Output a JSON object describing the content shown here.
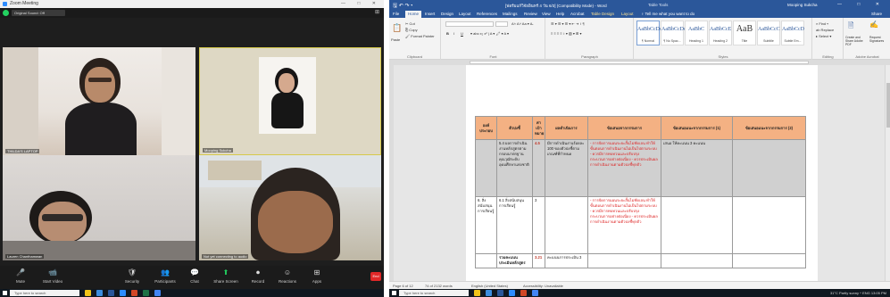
{
  "zoom": {
    "title": "Zoom Meeting",
    "window_controls": "— □ ✕",
    "original_sound": "Original Sound: Off",
    "gallery_icon": "gallery-view-icon",
    "participants": [
      {
        "name": "THILDA'S LAPTOP"
      },
      {
        "name": "Mooping Sukcha"
      },
      {
        "name": "Lauren Chanthamwan"
      },
      {
        "name": "Not yet connecting to audio"
      }
    ],
    "controls": [
      {
        "label": "Mute",
        "icon": "🎤",
        "name": "mute"
      },
      {
        "label": "Start Video",
        "icon": "📹",
        "name": "start-video"
      },
      {
        "label": "Security",
        "icon": "🛡",
        "name": "security"
      },
      {
        "label": "Participants",
        "icon": "👥",
        "name": "participants"
      },
      {
        "label": "Chat",
        "icon": "💬",
        "name": "chat"
      },
      {
        "label": "Share Screen",
        "icon": "⬆",
        "name": "share-screen",
        "accent": true
      },
      {
        "label": "Record",
        "icon": "⏺",
        "name": "record"
      },
      {
        "label": "Reactions",
        "icon": "☺",
        "name": "reactions"
      },
      {
        "label": "Apps",
        "icon": "⊞",
        "name": "apps"
      }
    ],
    "end_label": "End"
  },
  "word": {
    "quick_access": "🖫 ↶ ↷ ▾",
    "doc_title": "[ฟอร์มแก้วิจัยอินทร์ 4 วัน 6/3] (Compatibility Mode) - Word",
    "context_tab": "Table Tools",
    "user": "Mooping Sukcha",
    "window_controls": "— □ ✕",
    "tabs": [
      {
        "label": "File",
        "active": false
      },
      {
        "label": "Home",
        "active": true
      },
      {
        "label": "Insert",
        "active": false
      },
      {
        "label": "Design",
        "active": false
      },
      {
        "label": "Layout",
        "active": false
      },
      {
        "label": "References",
        "active": false
      },
      {
        "label": "Mailings",
        "active": false
      },
      {
        "label": "Review",
        "active": false
      },
      {
        "label": "View",
        "active": false
      },
      {
        "label": "Help",
        "active": false
      },
      {
        "label": "Acrobat",
        "active": false
      },
      {
        "label": "Table Design",
        "active": false,
        "tool": true
      },
      {
        "label": "Layout",
        "active": false,
        "tool": true
      },
      {
        "label": "♀ Tell me what you want to do",
        "active": false
      }
    ],
    "share_label": "Share",
    "ribbon": {
      "clipboard": {
        "paste": "Paste",
        "cut": "✂ Cut",
        "copy": "⎘ Copy",
        "format_painter": "🖌 Format Painter",
        "label": "Clipboard"
      },
      "font": {
        "bold": "B",
        "italic": "I",
        "underline": "U",
        "label": "Font"
      },
      "paragraph": {
        "label": "Paragraph"
      },
      "styles": {
        "label": "Styles",
        "items": [
          {
            "sample": "AaBbCcDc",
            "name": "¶ Normal"
          },
          {
            "sample": "AaBbCcDc",
            "name": "¶ No Spac..."
          },
          {
            "sample": "AaBbC",
            "name": "Heading 1"
          },
          {
            "sample": "AaBbCcE",
            "name": "Heading 2"
          },
          {
            "sample": "AaB",
            "name": "Title",
            "big": true
          },
          {
            "sample": "AaBbCcC",
            "name": "Subtitle"
          },
          {
            "sample": "AaBbCcD",
            "name": "Subtle Em..."
          }
        ]
      },
      "editing": {
        "find": "⌕ Find ▾",
        "replace": "ab Replace",
        "select": "▸ Select ▾",
        "label": "Editing"
      },
      "adobe": {
        "create": "Create and Share Adobe PDF",
        "request": "Request Signatures",
        "label": "Adobe Acrobat"
      }
    },
    "table": {
      "headers": [
        "องค์ประกอบ",
        "ตัวบ่งชี้",
        "ค่าเป้าหมาย",
        "ผลดำเนินการ",
        "ข้อเสนอจากกรรมการ",
        "ข้อเสนอแนะจากกรรมการ (1)",
        "ข้อเสนอแนะจากกรรมการ (2)"
      ],
      "rows": [
        {
          "c1": "",
          "c2": "5.4 ผลการดำเนินงานหลักสูตรตามกรอบมาตรฐานคุณวุฒิระดับอุดมศึกษาแห่งชาติ",
          "c3": "4.5",
          "c4": "มีการดำเนินงานร้อยละ 100 ของตัวบ่งชี้ตามเกณฑ์ที่กำหนด",
          "c5": "- การจัดการแผนระยะสั้นไม่ชัดเจน ทำให้ขั้นตอนการดำเนินงานไม่เป็นไปตามระบบ - ควรมีการทบทวนและปรับปรุงกระบวนการอย่างต่อเนื่อง - ควรประเมินผลการดำเนินงานตามตัวบ่งชี้ทุกตัว",
          "c6": "เสนอ ให้คะแนน 3 คะแนน",
          "c7": ""
        },
        {
          "c1": "6. สิ่งสนับสนุนการเรียนรู้",
          "c2": "6.1 สิ่งสนับสนุนการเรียนรู้",
          "c3": "3",
          "c4": "",
          "c5": "- การจัดการแผนระยะสั้นไม่ชัดเจน ทำให้ขั้นตอนการดำเนินงานไม่เป็นไปตามระบบ - ควรมีการทบทวนและปรับปรุงกระบวนการอย่างต่อเนื่อง - ควรประเมินผลการดำเนินงานตามตัวบ่งชี้ทุกตัว",
          "c6": "",
          "c7": ""
        },
        {
          "c1": "",
          "c2": "รวมคะแนนประเมินหลักสูตร",
          "c3": "3.21",
          "c4": "คะแนนการประเมิน 3",
          "c5": "",
          "c6": "",
          "c7": ""
        }
      ]
    },
    "status": {
      "page": "Page 6 of 12",
      "words": "74 of 2132 words",
      "lang": "English (United States)",
      "access": "Accessibility: Unavailable"
    }
  },
  "taskbar": {
    "search_placeholder": "Type here to search",
    "tray_right": "31°C  Partly sunny  ^  ENG  13:05 PM"
  },
  "colors": {
    "word_blue": "#2b579a",
    "table_header": "#f4b183",
    "zoom_green": "#23d160",
    "end_red": "#e02828"
  }
}
